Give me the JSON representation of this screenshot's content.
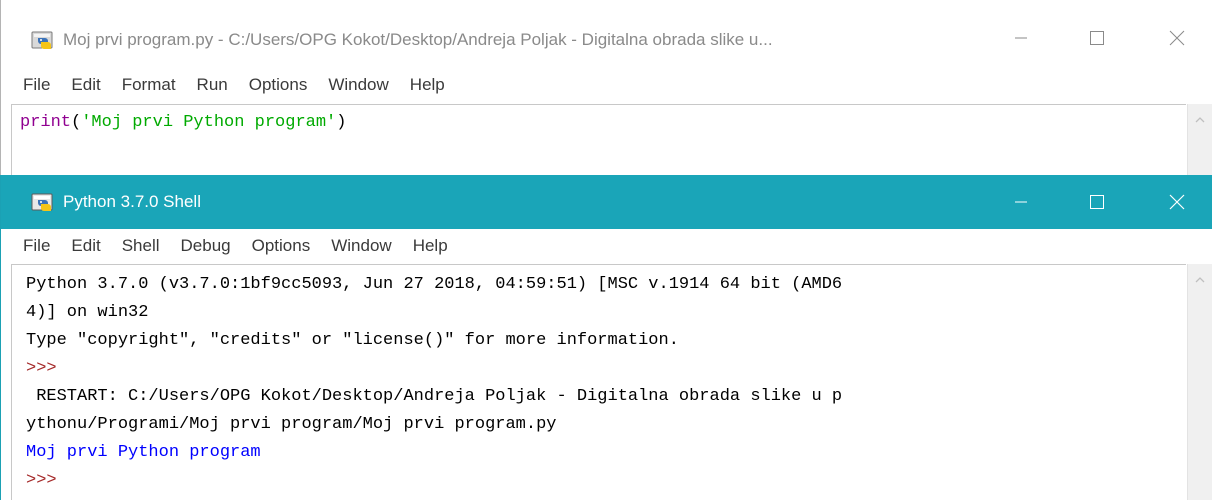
{
  "editor": {
    "title": "Moj prvi program.py - C:/Users/OPG Kokot/Desktop/Andreja Poljak - Digitalna obrada slike u...",
    "menu": [
      "File",
      "Edit",
      "Format",
      "Run",
      "Options",
      "Window",
      "Help"
    ],
    "code": {
      "func": "print",
      "open_paren": "(",
      "string": "'Moj prvi Python program'",
      "close_paren": ")"
    }
  },
  "shell": {
    "title": "Python 3.7.0 Shell",
    "menu": [
      "File",
      "Edit",
      "Shell",
      "Debug",
      "Options",
      "Window",
      "Help"
    ],
    "lines": [
      "Python 3.7.0 (v3.7.0:1bf9cc5093, Jun 27 2018, 04:59:51) [MSC v.1914 64 bit (AMD6",
      "4)] on win32",
      "Type \"copyright\", \"credits\" or \"license()\" for more information.",
      ">>>",
      " RESTART: C:/Users/OPG Kokot/Desktop/Andreja Poljak - Digitalna obrada slike u p",
      "ythonu/Programi/Moj prvi program/Moj prvi program.py",
      "Moj prvi Python program",
      ">>>"
    ]
  },
  "icons": {
    "app": "python-idle-icon",
    "minimize": "minimize-icon",
    "maximize": "maximize-icon",
    "close": "close-icon",
    "scroll_up": "scroll-up-arrow-icon"
  },
  "colors": {
    "shell_titlebar": "#1aa5b8",
    "keyword_purple": "#900090",
    "string_green": "#00aa00",
    "prompt_brown": "#a52a2a",
    "output_blue": "#0000ff",
    "restart_black": "#000000",
    "inactive_title": "#8a8a8a"
  }
}
